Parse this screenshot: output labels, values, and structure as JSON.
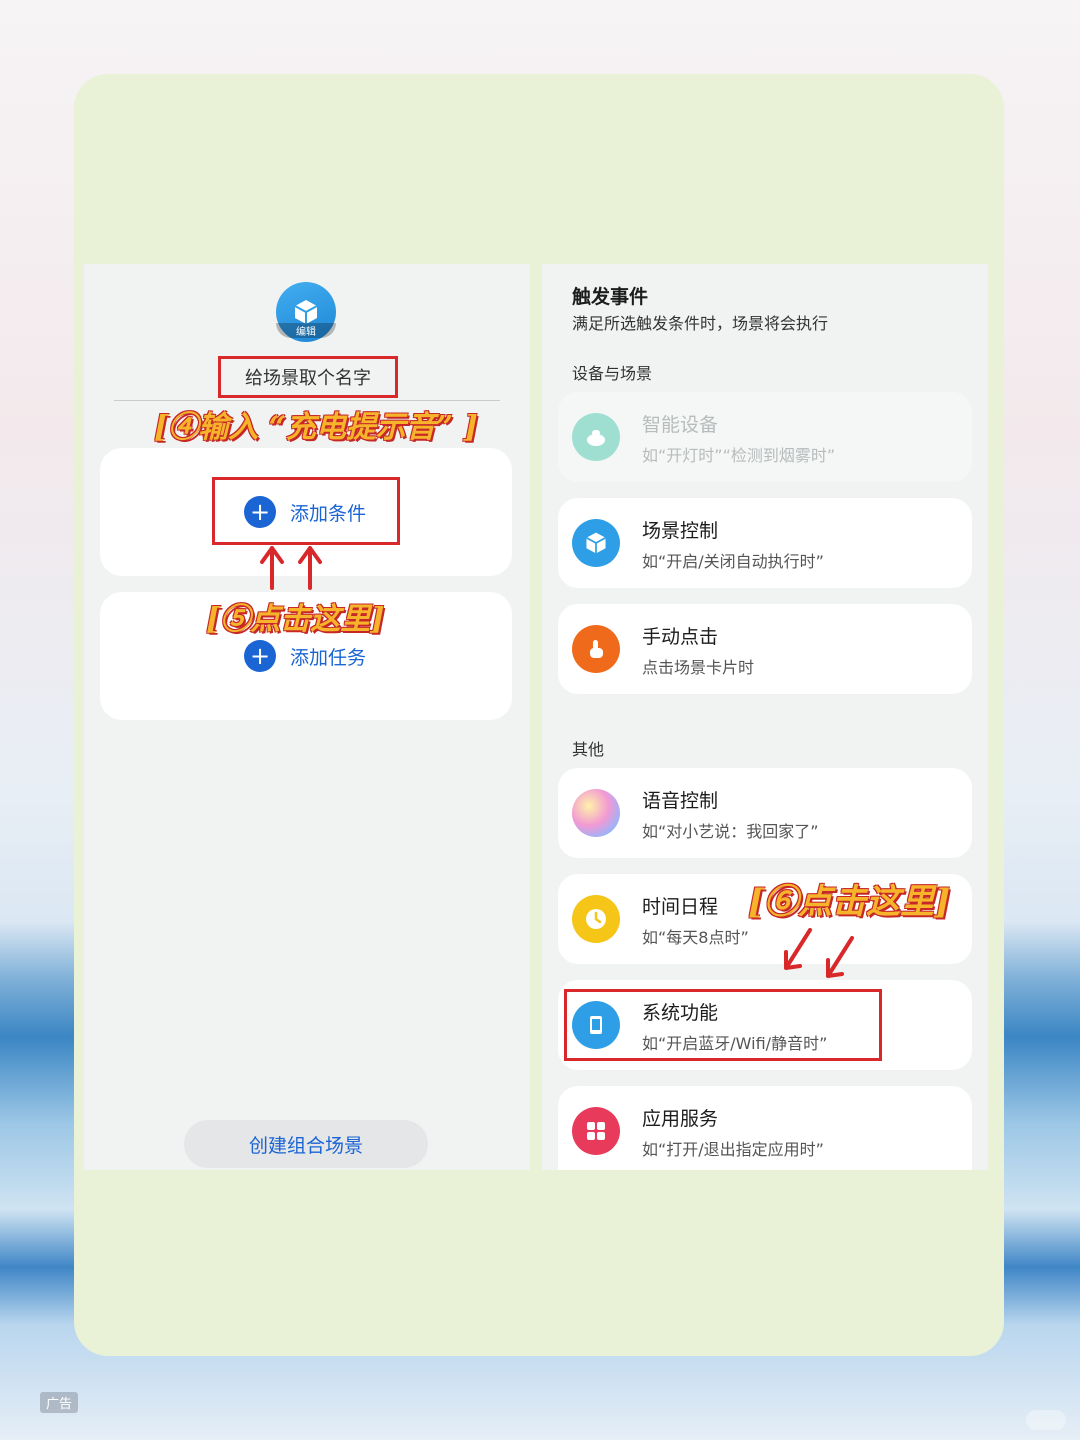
{
  "left_panel": {
    "scene_icon_badge": "编辑",
    "name_placeholder": "给场景取个名字",
    "annotation_step4": "[④输入 “充电提示音” ]",
    "add_condition_label": "添加条件",
    "annotation_step5": "[⑤点击这里]",
    "add_task_label": "添加任务",
    "create_button_label": "创建组合场景"
  },
  "right_panel": {
    "title": "触发事件",
    "subtitle": "满足所选触发条件时，场景将会执行",
    "section_devices": "设备与场景",
    "section_other": "其他",
    "annotation_step6": "[⑥点击这里]",
    "items": [
      {
        "title": "智能设备",
        "desc": "如“开灯时”“检测到烟雾时”",
        "icon": "robot-vacuum-icon",
        "color": "#9edfd2"
      },
      {
        "title": "场景控制",
        "desc": "如“开启/关闭自动执行时”",
        "icon": "cube-icon",
        "color": "#2e9fe6"
      },
      {
        "title": "手动点击",
        "desc": "点击场景卡片时",
        "icon": "tap-hand-icon",
        "color": "#f06a1c"
      },
      {
        "title": "语音控制",
        "desc": "如“对小艺说：我回家了”",
        "icon": "voice-orb-icon",
        "color": "#e58ac9"
      },
      {
        "title": "时间日程",
        "desc": "如“每天8点时”",
        "icon": "clock-icon",
        "color": "#f5c518"
      },
      {
        "title": "系统功能",
        "desc": "如“开启蓝牙/Wifi/静音时”",
        "icon": "phone-icon",
        "color": "#2e9fe6"
      },
      {
        "title": "应用服务",
        "desc": "如“打开/退出指定应用时”",
        "icon": "apps-grid-icon",
        "color": "#e83a5a"
      }
    ]
  },
  "footer": {
    "ad_label": "广告"
  },
  "colors": {
    "accent_blue": "#1a64d4",
    "highlight_red": "#d8282a",
    "annotation_gold": "#f7b42b",
    "frame_green": "#e9f1d7"
  }
}
